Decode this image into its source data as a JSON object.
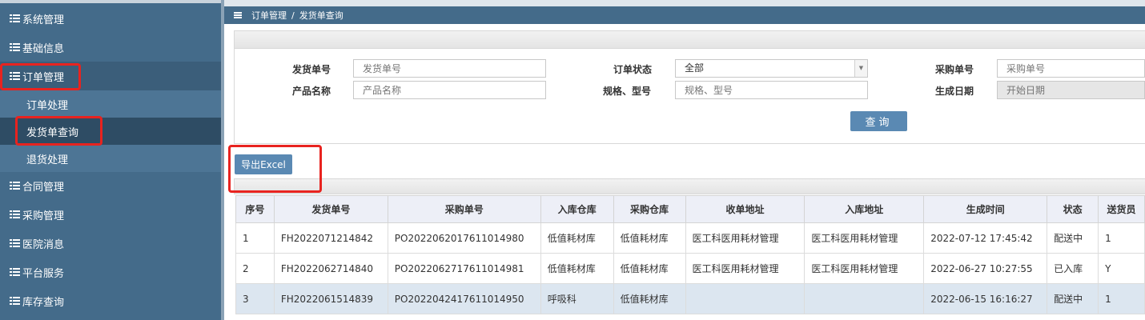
{
  "sidebar": {
    "items": [
      {
        "label": "系统管理"
      },
      {
        "label": "基础信息"
      },
      {
        "label": "订单管理"
      },
      {
        "label": "合同管理"
      },
      {
        "label": "采购管理"
      },
      {
        "label": "医院消息"
      },
      {
        "label": "平台服务"
      },
      {
        "label": "库存查询"
      }
    ],
    "subitems": [
      {
        "label": "订单处理"
      },
      {
        "label": "发货单查询"
      },
      {
        "label": "退货处理"
      }
    ]
  },
  "breadcrumb": {
    "parent": "订单管理",
    "separator": "/",
    "current": "发货单查询"
  },
  "search": {
    "ship_no_label": "发货单号",
    "ship_no_placeholder": "发货单号",
    "order_status_label": "订单状态",
    "order_status_value": "全部",
    "po_no_label": "采购单号",
    "po_no_placeholder": "采购单号",
    "product_label": "产品名称",
    "product_placeholder": "产品名称",
    "spec_label": "规格、型号",
    "spec_placeholder": "规格、型号",
    "date_label": "生成日期",
    "date_placeholder": "开始日期",
    "query_label": "查询"
  },
  "export_label": "导出Excel",
  "table": {
    "headers": [
      "序号",
      "发货单号",
      "采购单号",
      "入库仓库",
      "采购仓库",
      "收单地址",
      "入库地址",
      "生成时间",
      "状态",
      "送货员"
    ],
    "rows": [
      [
        "1",
        "FH2022071214842",
        "PO2022062017611014980",
        "低值耗材库",
        "低值耗材库",
        "医工科医用耗材管理",
        "医工科医用耗材管理",
        "2022-07-12 17:45:42",
        "配送中",
        "1"
      ],
      [
        "2",
        "FH2022062714840",
        "PO2022062717611014981",
        "低值耗材库",
        "低值耗材库",
        "医工科医用耗材管理",
        "医工科医用耗材管理",
        "2022-06-27 10:27:55",
        "已入库",
        "Y"
      ],
      [
        "3",
        "FH2022061514839",
        "PO2022042417611014950",
        "呼吸科",
        "低值耗材库",
        "",
        "",
        "2022-06-15 16:16:27",
        "配送中",
        "1"
      ]
    ]
  },
  "colors": {
    "sidebar": "#446b8a",
    "accent": "#5a89b3",
    "highlight": "#e8231f"
  }
}
